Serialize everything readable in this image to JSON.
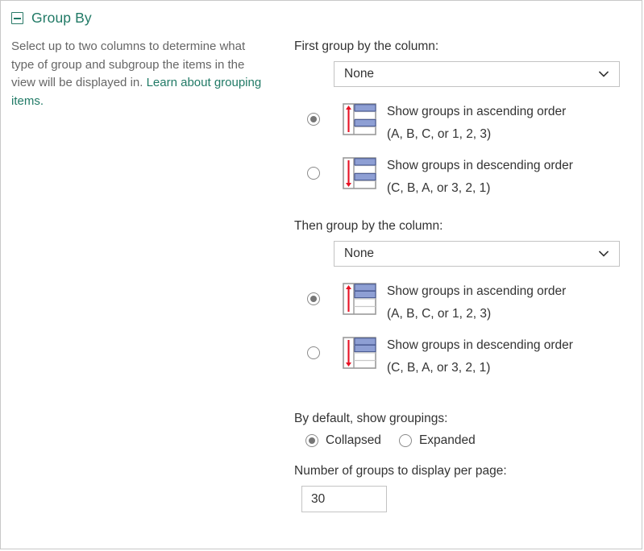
{
  "panel": {
    "title": "Group By",
    "collapse_icon": "collapse-minus-icon",
    "description_part1": "Select up to two columns to determine what type of group and subgroup the items in the view will be displayed in. ",
    "description_link": "Learn about grouping items.",
    "accent_color": "#217a66",
    "text_color": "#333333",
    "muted_text_color": "#666666",
    "border_color": "#c3c3c3"
  },
  "first_group": {
    "label": "First group by the column:",
    "select_value": "None",
    "chevron_icon": "chevron-down-icon",
    "options": [
      {
        "id": "ascending",
        "icon": "sort-ascending-icon",
        "line1": "Show groups in ascending order",
        "line2": "(A, B, C, or 1, 2, 3)",
        "selected": true
      },
      {
        "id": "descending",
        "icon": "sort-descending-icon",
        "line1": "Show groups in descending order",
        "line2": "(C, B, A, or 3, 2, 1)",
        "selected": false
      }
    ]
  },
  "second_group": {
    "label": "Then group by the column:",
    "select_value": "None",
    "chevron_icon": "chevron-down-icon",
    "options": [
      {
        "id": "ascending",
        "icon": "sort-ascending-icon",
        "line1": "Show groups in ascending order",
        "line2": "(A, B, C, or 1, 2, 3)",
        "selected": true
      },
      {
        "id": "descending",
        "icon": "sort-descending-icon",
        "line1": "Show groups in descending order",
        "line2": "(C, B, A, or 3, 2, 1)",
        "selected": false
      }
    ]
  },
  "default_display": {
    "label": "By default, show groupings:",
    "collapsed_label": "Collapsed",
    "expanded_label": "Expanded",
    "selected": "Collapsed"
  },
  "groups_per_page": {
    "label": "Number of groups to display per page:",
    "value": "30"
  }
}
